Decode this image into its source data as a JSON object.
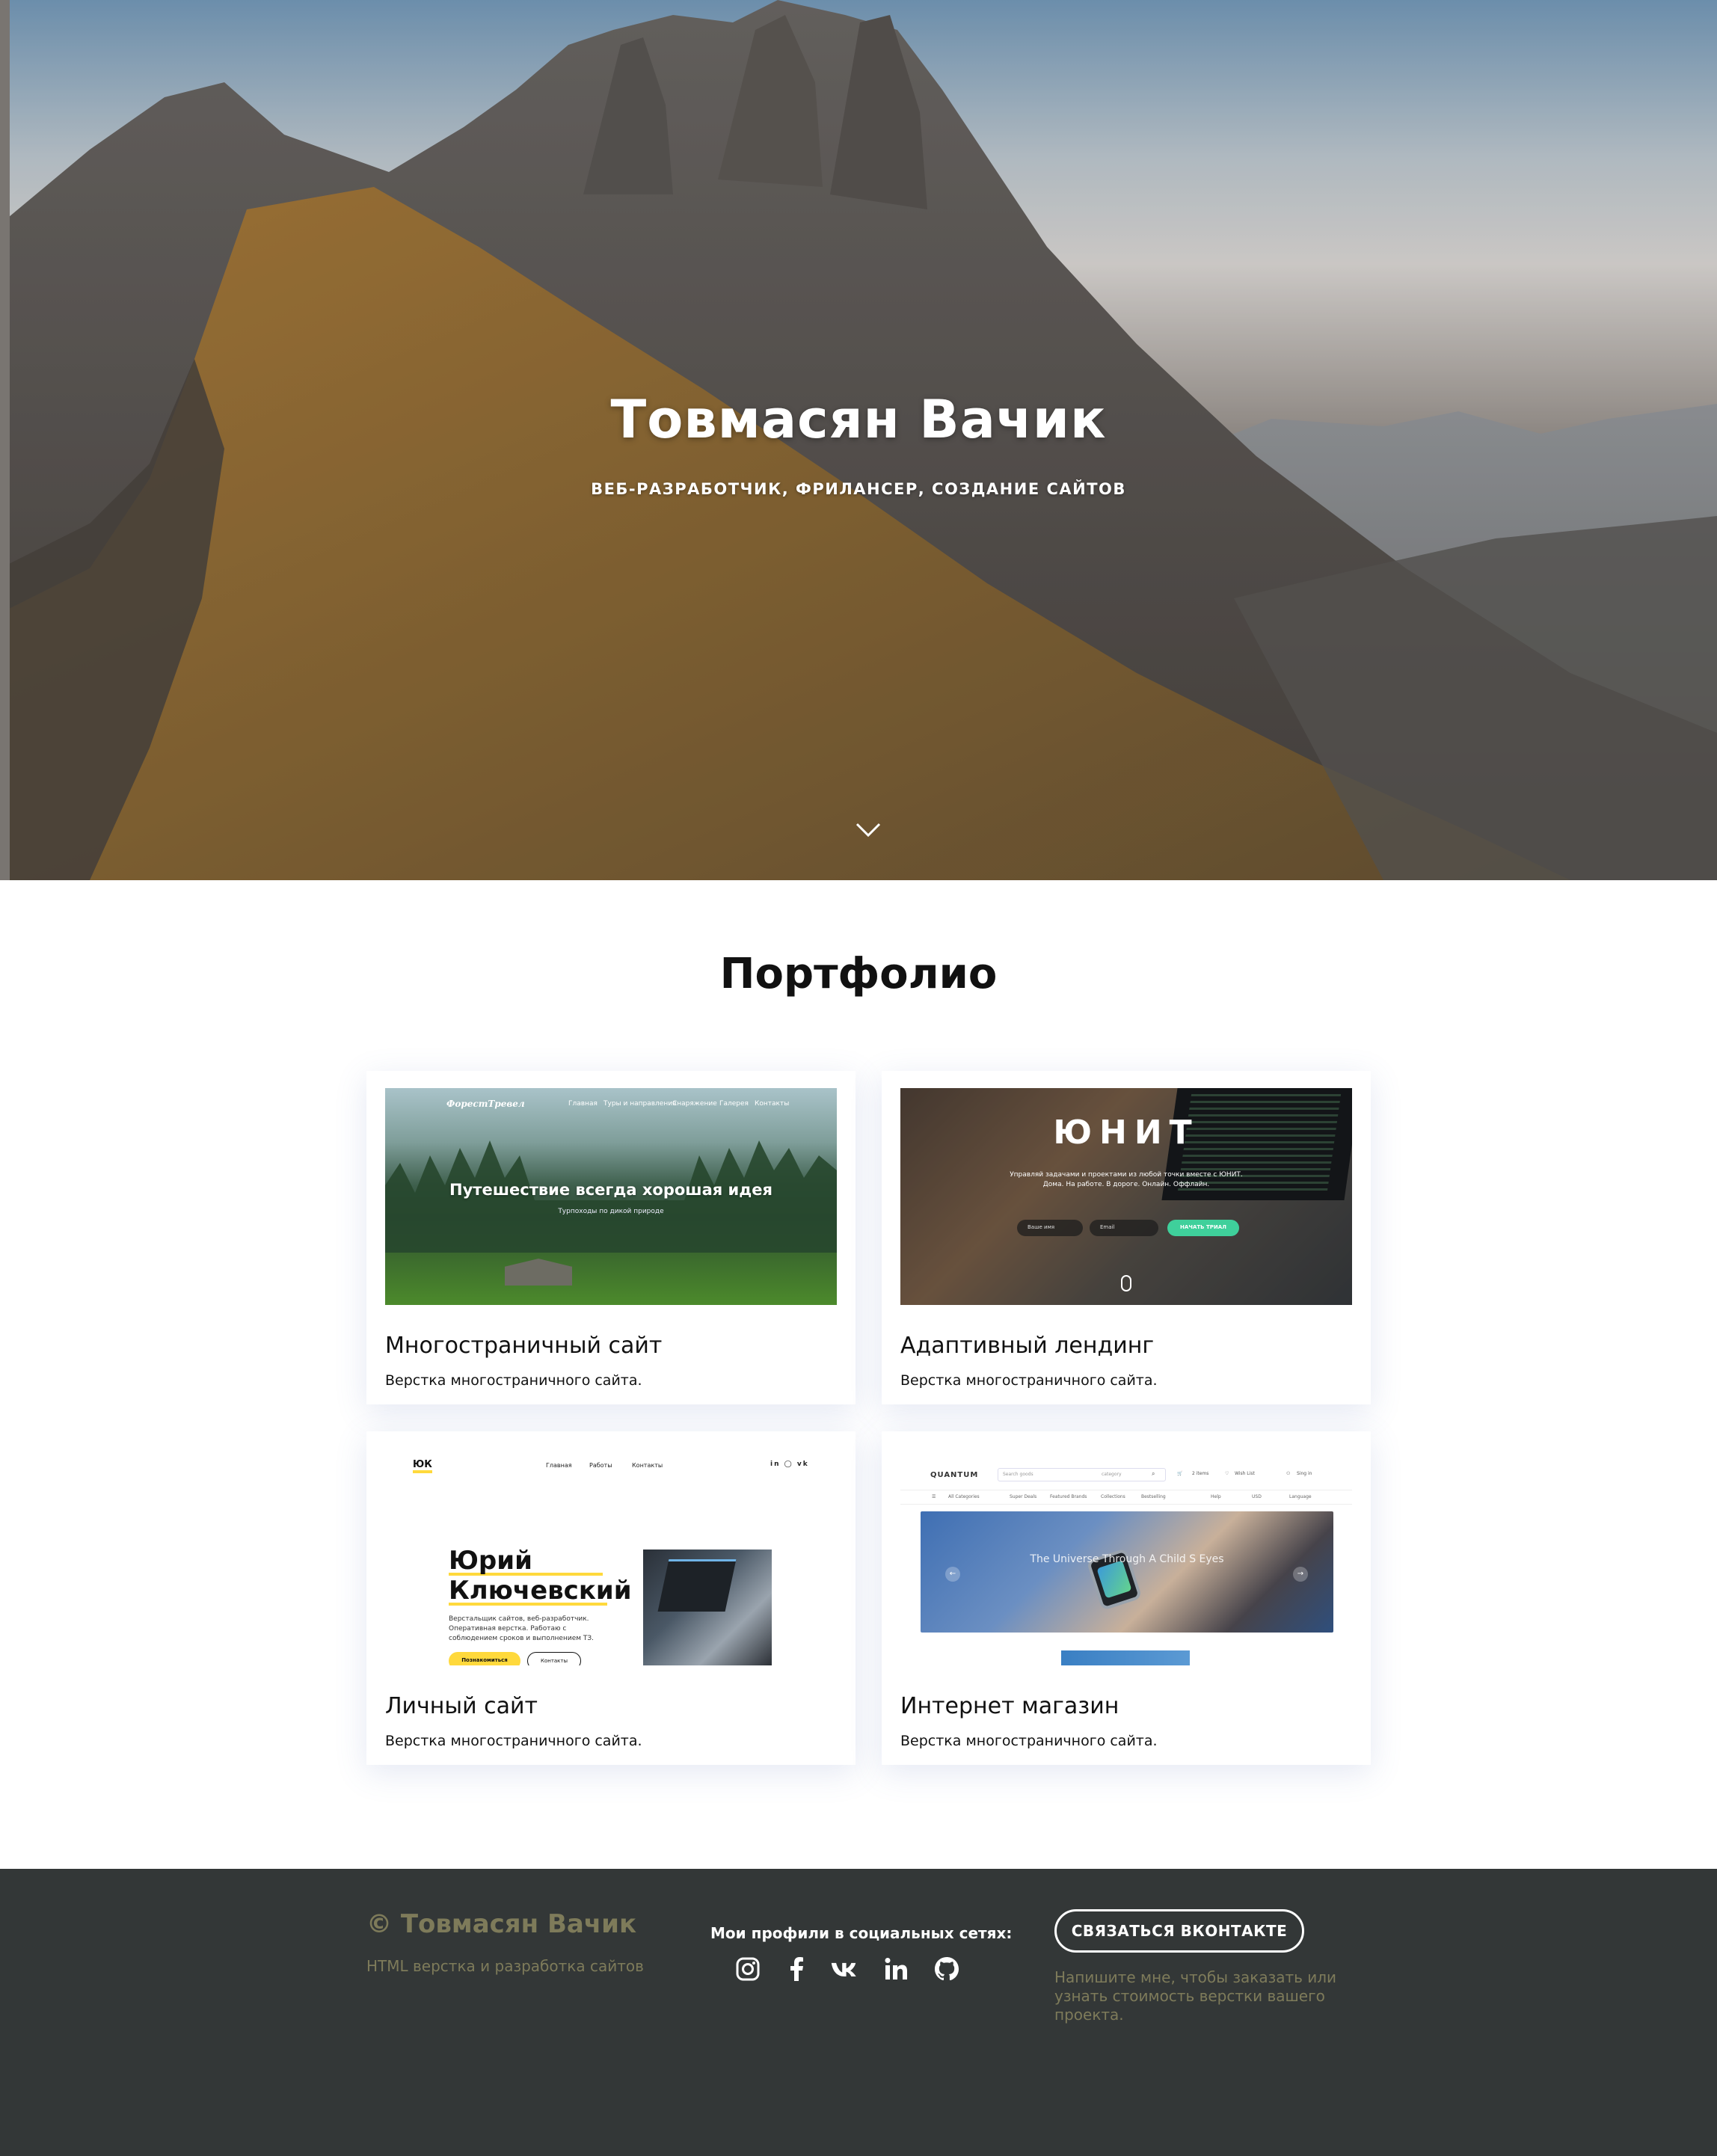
{
  "hero": {
    "title": "Товмасян Вачик",
    "subtitle": "ВЕБ-РАЗРАБОТЧИК, ФРИЛАНСЕР, СОЗДАНИЕ САЙТОВ",
    "scroll_icon": "chevron-down-icon"
  },
  "portfolio": {
    "title": "Портфолио",
    "items": [
      {
        "title": "Многостраничный сайт",
        "desc": "Верстка многостраничного сайта.",
        "preview": {
          "logo": "ФорестТревел",
          "nav": [
            "Главная",
            "Туры и направления",
            "Снаряжение",
            "Галерея",
            "Контакты"
          ],
          "headline": "Путешествие всегда хорошая идея",
          "sub": "Турпоходы по дикой природе"
        }
      },
      {
        "title": "Адаптивный лендинг",
        "desc": "Верстка многостраничного сайта.",
        "preview": {
          "brand": "ЮНИТ",
          "tagline_1": "Управляй задачами и проектами из любой точки вместе с ЮНИТ.",
          "tagline_2": "Дома. На работе. В дороге. Онлайн. Оффлайн.",
          "field_name": "Ваше имя",
          "field_email": "Email",
          "button": "НАЧАТЬ ТРИАЛ"
        }
      },
      {
        "title": "Личный сайт",
        "desc": "Верстка многостраничного сайта.",
        "preview": {
          "logo": "ЮК",
          "nav": [
            "Главная",
            "Работы",
            "Контакты"
          ],
          "social": "in ◯ vk",
          "name_line1": "Юрий",
          "name_line2": "Ключевский",
          "bio": "Верстальщик сайтов, веб-разработчик. Оперативная верстка. Работаю с соблюдением сроков и выполнением ТЗ.",
          "button_primary": "Познакомиться",
          "button_secondary": "Контакты"
        }
      },
      {
        "title": "Интернет магазин",
        "desc": "Верстка многостраничного сайта.",
        "preview": {
          "logo": "QUANTUM",
          "search_placeholder": "Search goods",
          "search_category": "category",
          "cart": "2 items",
          "wishlist": "Wish List",
          "login": "Sing in",
          "nav": [
            "All Categories",
            "Super Deals",
            "Featured Brands",
            "Collections",
            "Bestselling"
          ],
          "help": "Help",
          "currency": "USD",
          "language": "Language",
          "slogan": "The Universe Through A Child S Eyes"
        }
      }
    ]
  },
  "footer": {
    "brand": "© Товмасян Вачик",
    "tagline": "HTML верстка и разработка сайтов",
    "social_title": "Мои профили в социальных сетях:",
    "social_icons": [
      "instagram-icon",
      "facebook-icon",
      "vk-icon",
      "linkedin-icon",
      "github-icon"
    ],
    "cta": "СВЯЗАТЬСЯ ВКОНТАКТЕ",
    "note": "Напишите мне, чтобы заказать или узнать стоимость верстки вашего проекта."
  },
  "colors": {
    "footer_bg": "#333737",
    "footer_muted": "#7e7b5a",
    "accent_yellow": "#ffd93c",
    "accent_green": "#3fd09b"
  }
}
